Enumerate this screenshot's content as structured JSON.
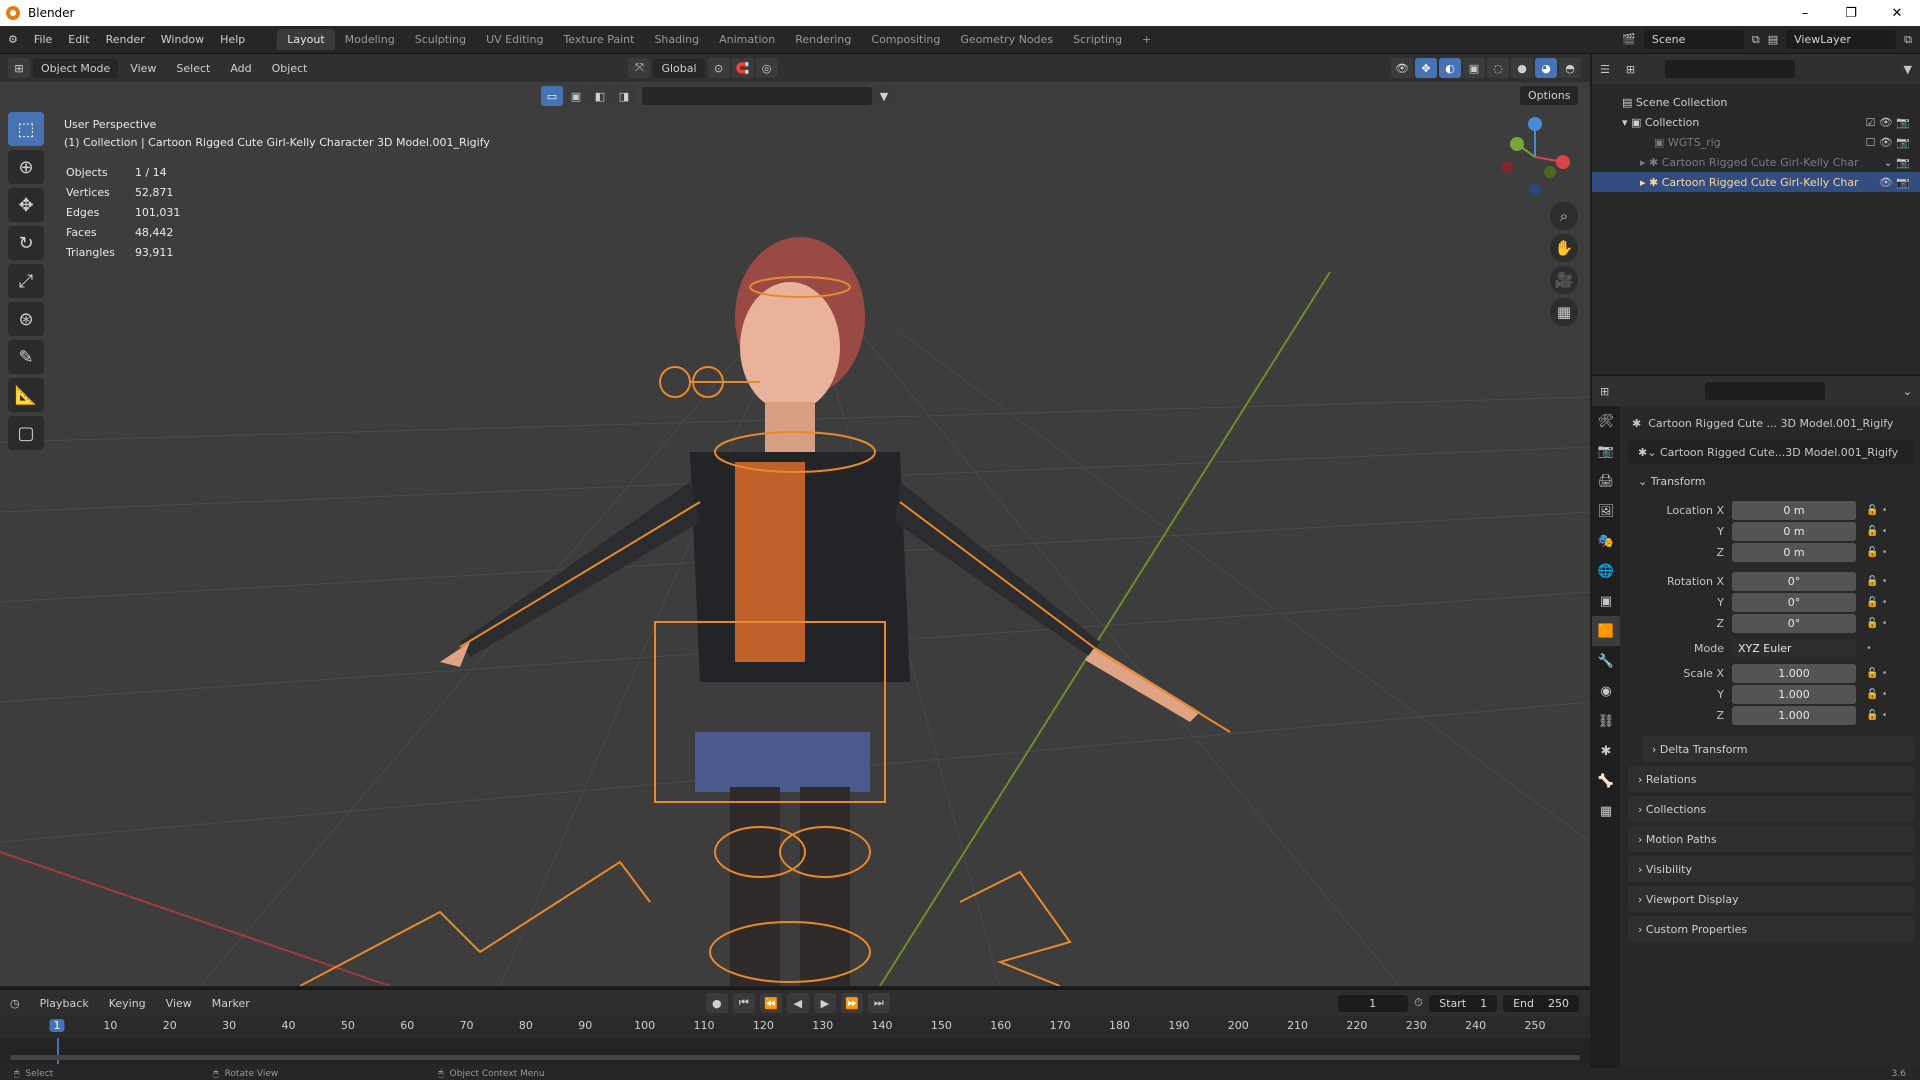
{
  "window": {
    "title": "Blender",
    "buttons": [
      "–",
      "❐",
      "✕"
    ]
  },
  "menu": [
    "File",
    "Edit",
    "Render",
    "Window",
    "Help"
  ],
  "workspaces": [
    "Layout",
    "Modeling",
    "Sculpting",
    "UV Editing",
    "Texture Paint",
    "Shading",
    "Animation",
    "Rendering",
    "Compositing",
    "Geometry Nodes",
    "Scripting"
  ],
  "add_workspace": "+",
  "scene": "Scene",
  "view_layer": "ViewLayer",
  "viewport_header": {
    "mode": "Object Mode",
    "menus": [
      "View",
      "Select",
      "Add",
      "Object"
    ],
    "orientation": "Global",
    "options": "Options"
  },
  "overlay": {
    "perspective": "User Perspective",
    "collection_path": "(1) Collection | Cartoon Rigged Cute Girl-Kelly Character 3D Model.001_Rigify",
    "stats": [
      {
        "label": "Objects",
        "value": "1 / 14"
      },
      {
        "label": "Vertices",
        "value": "52,871"
      },
      {
        "label": "Edges",
        "value": "101,031"
      },
      {
        "label": "Faces",
        "value": "48,442"
      },
      {
        "label": "Triangles",
        "value": "93,911"
      }
    ]
  },
  "outliner": {
    "rows": [
      {
        "label": "Scene Collection",
        "depth": 0
      },
      {
        "label": "Collection",
        "depth": 1
      },
      {
        "label": "WGTS_rig",
        "depth": 2
      },
      {
        "label": "Cartoon Rigged Cute Girl-Kelly Char",
        "depth": 2
      },
      {
        "label": "Cartoon Rigged Cute Girl-Kelly Char",
        "depth": 2,
        "selected": true
      }
    ]
  },
  "properties": {
    "object_name": "Cartoon Rigged Cute ... 3D Model.001_Rigify",
    "data_name": "Cartoon Rigged Cute...3D Model.001_Rigify",
    "transform_title": "Transform",
    "location": [
      {
        "label": "Location X",
        "value": "0 m"
      },
      {
        "label": "Y",
        "value": "0 m"
      },
      {
        "label": "Z",
        "value": "0 m"
      }
    ],
    "rotation": [
      {
        "label": "Rotation X",
        "value": "0°"
      },
      {
        "label": "Y",
        "value": "0°"
      },
      {
        "label": "Z",
        "value": "0°"
      }
    ],
    "mode": {
      "label": "Mode",
      "value": "XYZ Euler"
    },
    "scale": [
      {
        "label": "Scale X",
        "value": "1.000"
      },
      {
        "label": "Y",
        "value": "1.000"
      },
      {
        "label": "Z",
        "value": "1.000"
      }
    ],
    "delta": "Delta Transform",
    "sections": [
      "Relations",
      "Collections",
      "Motion Paths",
      "Visibility",
      "Viewport Display",
      "Custom Properties"
    ]
  },
  "timeline": {
    "menus": [
      "Playback",
      "Keying",
      "View",
      "Marker"
    ],
    "current_frame": "1",
    "start_label": "Start",
    "start": "1",
    "end_label": "End",
    "end": "250",
    "ticks": [
      "1",
      "10",
      "20",
      "30",
      "40",
      "50",
      "60",
      "70",
      "80",
      "90",
      "100",
      "110",
      "120",
      "130",
      "140",
      "150",
      "160",
      "170",
      "180",
      "190",
      "200",
      "210",
      "220",
      "230",
      "240",
      "250"
    ]
  },
  "statusbar": {
    "items": [
      "Select",
      "Rotate View",
      "Object Context Menu"
    ],
    "version": "3.6"
  },
  "colors": {
    "accent": "#4772b3",
    "selection": "#e8892b",
    "bg_viewport": "#3d3d3d"
  }
}
